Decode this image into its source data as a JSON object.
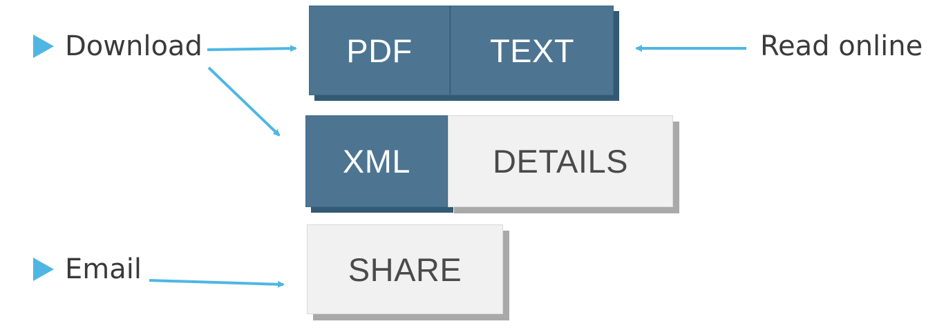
{
  "labels": {
    "download": "Download",
    "email": "Email",
    "read_online": "Read online"
  },
  "buttons": {
    "pdf": "PDF",
    "text": "TEXT",
    "xml": "XML",
    "details": "DETAILS",
    "share": "SHARE"
  },
  "colors": {
    "accent_arrow": "#4fb6e4",
    "button_dark": "#4d7592",
    "button_light": "#f1f1f1"
  }
}
